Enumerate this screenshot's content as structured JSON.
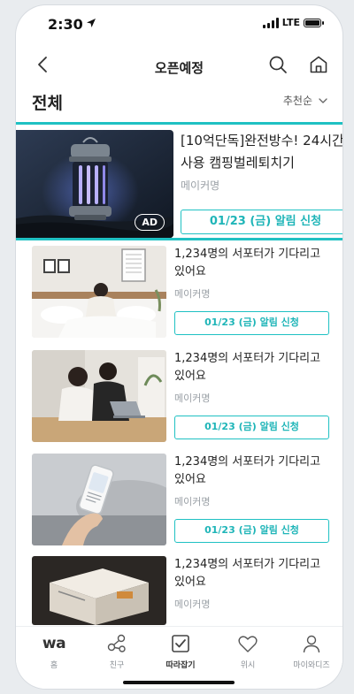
{
  "status": {
    "time": "2:30",
    "network": "LTE"
  },
  "nav": {
    "title": "오픈예정"
  },
  "section": {
    "heading": "전체",
    "sort_label": "추천순"
  },
  "featured": {
    "title": "[10억단독]완전방수! 24시간 사용 캠핑벌레퇴치기",
    "maker": "메이커명",
    "ad_badge": "AD",
    "button": "01/23 (금) 알림 신청"
  },
  "items": [
    {
      "desc": "1,234명의 서포터가 기다리고 있어요",
      "maker": "메이커명",
      "button": "01/23 (금) 알림 신청"
    },
    {
      "desc": "1,234명의 서포터가 기다리고 있어요",
      "maker": "메이커명",
      "button": "01/23 (금) 알림 신청"
    },
    {
      "desc": "1,234명의 서포터가 기다리고 있어요",
      "maker": "메이커명",
      "button": "01/23 (금) 알림 신청"
    },
    {
      "desc": "1,234명의 서포터가 기다리고 있어요",
      "maker": "메이커명",
      "button": ""
    }
  ],
  "tabbar": {
    "logo": "wa",
    "tabs": [
      {
        "label": "홈"
      },
      {
        "label": "친구"
      },
      {
        "label": "따라잡기"
      },
      {
        "label": "위시"
      },
      {
        "label": "마이와디즈"
      }
    ],
    "active_index": 2
  },
  "colors": {
    "accent": "#1fc1c3",
    "text": "#222222",
    "muted": "#9aa0a6"
  }
}
